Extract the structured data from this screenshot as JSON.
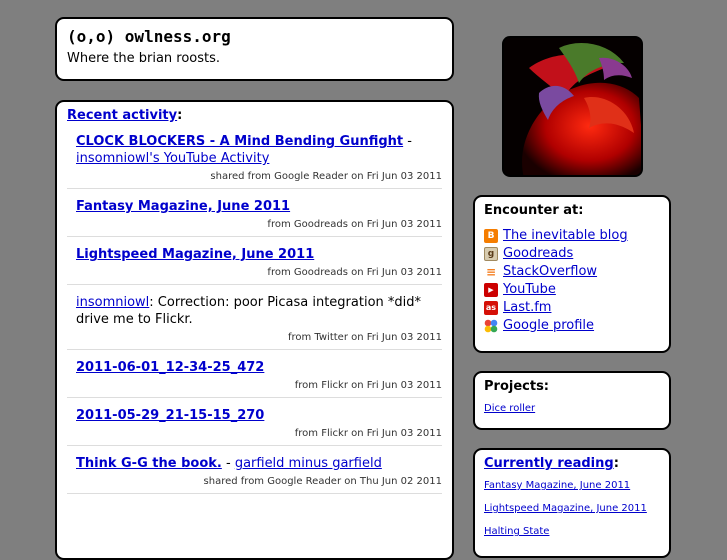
{
  "header": {
    "title": "(o,o) owlness.org",
    "tagline": "Where the brian roosts."
  },
  "activity": {
    "heading_link": "Recent activity",
    "heading_suffix": ":",
    "items": [
      {
        "title": "CLOCK BLOCKERS - A Mind Bending Gunfight",
        "sep": " - ",
        "sub": "insomniowl's YouTube Activity",
        "meta": "shared from Google Reader on Fri Jun 03 2011"
      },
      {
        "title": "Fantasy Magazine, June 2011",
        "meta": "from Goodreads on Fri Jun 03 2011"
      },
      {
        "title": "Lightspeed Magazine, June 2011",
        "meta": "from Goodreads on Fri Jun 03 2011"
      },
      {
        "user": "insomniowl",
        "text": ": Correction: poor Picasa integration *did* drive me to Flickr.",
        "meta": "from Twitter on Fri Jun 03 2011"
      },
      {
        "title": "2011-06-01_12-34-25_472",
        "meta": "from Flickr on Fri Jun 03 2011"
      },
      {
        "title": "2011-05-29_21-15-15_270",
        "meta": "from Flickr on Fri Jun 03 2011"
      },
      {
        "title": "Think G-G the book.",
        "sep": " - ",
        "sub": "garfield minus garfield",
        "meta": "shared from Google Reader on Thu Jun 02 2011"
      }
    ]
  },
  "encounter": {
    "heading": "Encounter at:",
    "links": [
      {
        "label": "The inevitable blog",
        "icon": "blogger-icon",
        "color": "#f57d00",
        "glyph": "B"
      },
      {
        "label": "Goodreads",
        "icon": "goodreads-icon",
        "color": "#d8ccb0",
        "glyph": "g"
      },
      {
        "label": "StackOverflow",
        "icon": "stackoverflow-icon",
        "color": "#ffffff",
        "glyph": "≡"
      },
      {
        "label": "YouTube",
        "icon": "youtube-icon",
        "color": "#cc0000",
        "glyph": "▶"
      },
      {
        "label": "Last.fm",
        "icon": "lastfm-icon",
        "color": "#d51007",
        "glyph": "as"
      },
      {
        "label": "Google profile",
        "icon": "google-icon",
        "color": "#ffffff",
        "glyph": "✦"
      }
    ]
  },
  "projects": {
    "heading": "Projects:",
    "links": [
      "Dice roller"
    ]
  },
  "reading": {
    "heading_link": "Currently reading",
    "heading_suffix": ":",
    "books": [
      "Fantasy Magazine, June 2011",
      "Lightspeed Magazine, June 2011",
      "Halting State"
    ]
  }
}
